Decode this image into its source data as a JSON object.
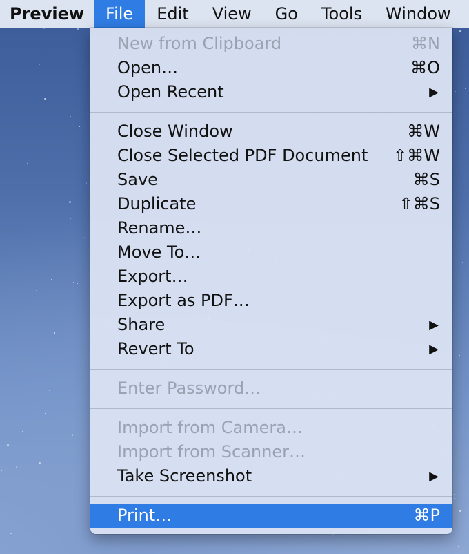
{
  "menubar": {
    "app_name": "Preview",
    "items": [
      "File",
      "Edit",
      "View",
      "Go",
      "Tools",
      "Window"
    ],
    "active_item": "File"
  },
  "file_menu": {
    "groups": [
      [
        {
          "label": "New from Clipboard",
          "shortcut": "⌘N",
          "disabled": true
        },
        {
          "label": "Open…",
          "shortcut": "⌘O"
        },
        {
          "label": "Open Recent",
          "submenu": true
        }
      ],
      [
        {
          "label": "Close Window",
          "shortcut": "⌘W"
        },
        {
          "label": "Close Selected PDF Document",
          "shortcut": "⇧⌘W"
        },
        {
          "label": "Save",
          "shortcut": "⌘S"
        },
        {
          "label": "Duplicate",
          "shortcut": "⇧⌘S"
        },
        {
          "label": "Rename…"
        },
        {
          "label": "Move To…"
        },
        {
          "label": "Export…"
        },
        {
          "label": "Export as PDF…"
        },
        {
          "label": "Share",
          "submenu": true
        },
        {
          "label": "Revert To",
          "submenu": true
        }
      ],
      [
        {
          "label": "Enter Password…",
          "disabled": true
        }
      ],
      [
        {
          "label": "Import from Camera…",
          "disabled": true
        },
        {
          "label": "Import from Scanner…",
          "disabled": true
        },
        {
          "label": "Take Screenshot",
          "submenu": true
        }
      ],
      [
        {
          "label": "Print…",
          "shortcut": "⌘P",
          "selected": true
        }
      ]
    ],
    "submenu_arrow": "▶"
  },
  "colors": {
    "selection": "#2f7ce4",
    "disabled_text": "#9aa3b2"
  }
}
